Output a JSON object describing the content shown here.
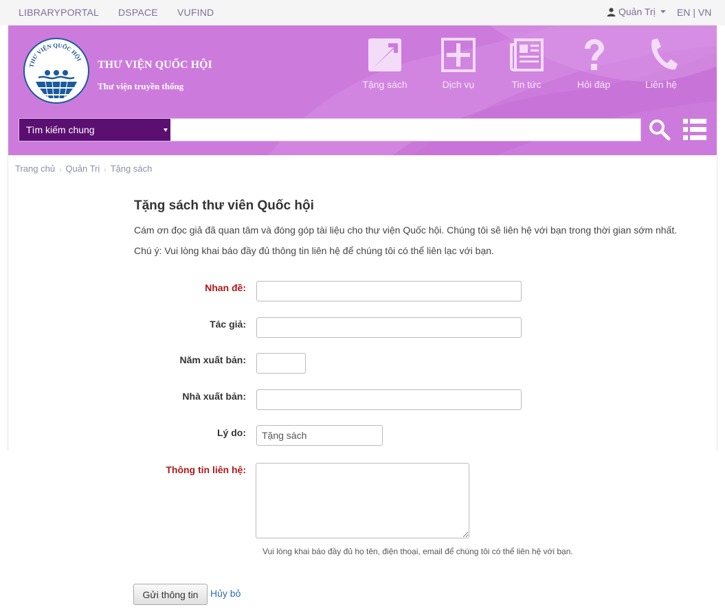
{
  "topnav": {
    "links": [
      "LIBRARYPORTAL",
      "DSPACE",
      "VUFIND"
    ],
    "user_label": "Quản Trị",
    "lang": "EN | VN"
  },
  "header": {
    "logo_text": "THƯ VIỆN QUỐC HỘI",
    "brand_title": "THƯ VIỆN QUỐC HỘI",
    "brand_sub": "Thư viện truyền thống",
    "nav": [
      {
        "label": "Tặng sách",
        "icon": "donate-icon"
      },
      {
        "label": "Dịch vụ",
        "icon": "plus-box-icon"
      },
      {
        "label": "Tin tức",
        "icon": "newspaper-icon"
      },
      {
        "label": "Hỏi đáp",
        "icon": "question-icon"
      },
      {
        "label": "Liên hệ",
        "icon": "phone-icon"
      }
    ],
    "search": {
      "type_label": "Tìm kiếm chung",
      "placeholder": ""
    },
    "accent_color": "#cc7bdc",
    "search_type_color": "#5b0f71"
  },
  "breadcrumb": [
    "Trang chủ",
    "Quản Trị",
    "Tặng sách"
  ],
  "main": {
    "title": "Tặng sách thư viên Quốc hội",
    "intro": "Cám ơn đọc giả đã quan tâm và đóng góp tài liệu cho thư viện Quốc hội. Chúng tôi sẽ liên hệ với bạn trong thời gian sớm nhất.",
    "note": "Chú ý: Vui lòng khai báo đầy đủ thông tin liên hệ để chúng tôi có thể liên lạc với bạn.",
    "form": {
      "title_label": "Nhan đề:",
      "author_label": "Tác giả:",
      "year_label": "Năm xuất bản:",
      "publisher_label": "Nhà xuất bản:",
      "reason_label": "Lý do:",
      "reason_value": "Tặng sách",
      "contact_label": "Thông tin liên hệ:",
      "contact_hint": "Vui lòng khai báo đầy đủ họ tên, điện thoại, email để chúng tôi có thể liên hệ với bạn.",
      "submit_label": "Gửi thông tin",
      "cancel_label": "Hủy bỏ",
      "required_color": "#b0181b"
    }
  }
}
